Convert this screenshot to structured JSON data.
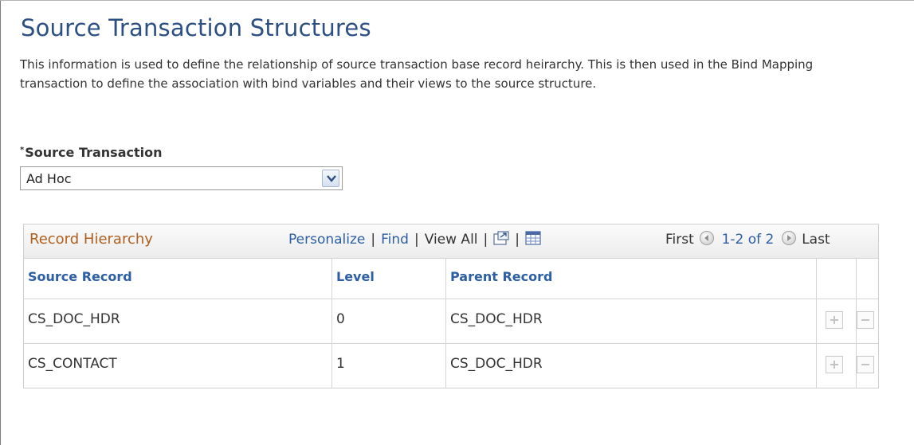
{
  "page": {
    "title": "Source Transaction Structures",
    "description": "This information is used to define the relationship of source transaction base record heirarchy. This is then used in the Bind Mapping transaction to define the association with bind variables and their views to the source structure."
  },
  "source_transaction": {
    "required_marker": "*",
    "label": "Source Transaction",
    "value": "Ad Hoc"
  },
  "grid": {
    "title": "Record Hierarchy",
    "nav": {
      "personalize": "Personalize",
      "find": "Find",
      "view_all": "View All",
      "separator": "|"
    },
    "pager": {
      "first": "First",
      "range": "1-2 of 2",
      "last": "Last"
    },
    "columns": [
      "Source Record",
      "Level",
      "Parent Record"
    ],
    "rows": [
      {
        "source_record": "CS_DOC_HDR",
        "level": "0",
        "parent_record": "CS_DOC_HDR"
      },
      {
        "source_record": "CS_CONTACT",
        "level": "1",
        "parent_record": "CS_DOC_HDR"
      }
    ]
  },
  "icons": {
    "dropdown": "chevron-down-icon",
    "zoom": "new-window-icon",
    "download": "spreadsheet-icon",
    "previous": "previous-arrow-icon",
    "next": "next-arrow-icon",
    "add_row": "plus-icon",
    "delete_row": "minus-icon"
  },
  "colors": {
    "title": "#2c4f84",
    "link": "#2c5fa3",
    "grid_title": "#b05f1e"
  }
}
